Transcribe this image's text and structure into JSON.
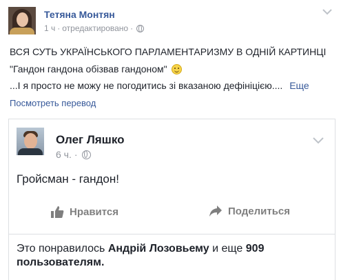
{
  "post": {
    "author": "Тетяна Монтян",
    "time": "1 ч",
    "edited": "отредактировано",
    "separator": "·",
    "line1": "ВСЯ СУТЬ УКРАЇНСЬКОГО ПАРЛАМЕНТАРИЗМУ В ОДНІЙ КАРТИНЦІ",
    "line2": "\"Гандон гандона обізвав гандоном\"",
    "line3": "...І я просто не можу не погодитись зі вказаною дефініцією....",
    "see_more": "Еще",
    "translate": "Посмотреть перевод"
  },
  "shared": {
    "author": "Олег Ляшко",
    "time": "6 ч.",
    "separator": "·",
    "text": "Гройсман - гандон!",
    "like_label": "Нравится",
    "share_label": "Поделиться",
    "likes_prefix": "Это понравилось ",
    "likes_name": "Андрій Лозовьему",
    "likes_middle": " и еще ",
    "likes_count": "909 пользователям.",
    "likes_suffix": ""
  },
  "icons": {
    "globe": "globe-icon",
    "chevron": "chevron-down-icon",
    "smile": "smile-icon",
    "like": "thumbs-up-icon",
    "share": "share-arrow-icon"
  },
  "colors": {
    "link": "#365899",
    "meta": "#90949c",
    "text": "#1d2129",
    "action": "#7f7f7f",
    "border": "#dddfe2"
  }
}
